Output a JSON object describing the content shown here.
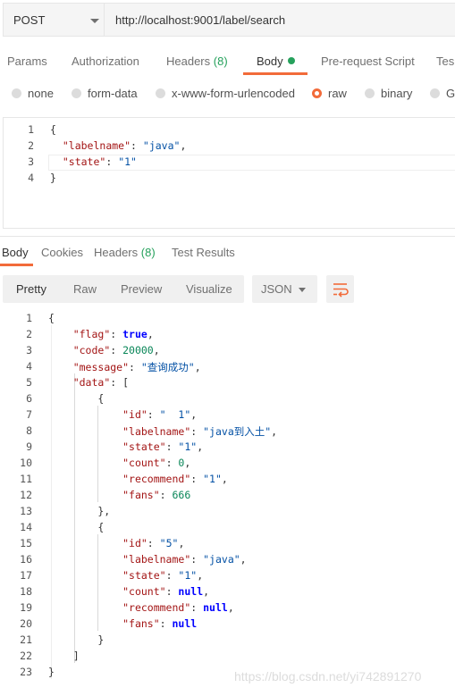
{
  "request": {
    "method": "POST",
    "url": "http://localhost:9001/label/search"
  },
  "request_tabs": [
    {
      "label": "Params"
    },
    {
      "label": "Authorization"
    },
    {
      "label": "Headers",
      "count": "(8)"
    },
    {
      "label": "Body"
    },
    {
      "label": "Pre-request Script"
    },
    {
      "label": "Tes"
    }
  ],
  "body_types": [
    "none",
    "form-data",
    "x-www-form-urlencoded",
    "raw",
    "binary",
    "G"
  ],
  "body_selected": "raw",
  "request_body_lines": [
    [
      [
        "p",
        "{"
      ]
    ],
    [
      [
        "p",
        "  "
      ],
      [
        "k",
        "\"labelname\""
      ],
      [
        "p",
        ": "
      ],
      [
        "s",
        "\"java\""
      ],
      [
        "p",
        ","
      ]
    ],
    [
      [
        "p",
        "  "
      ],
      [
        "k",
        "\"state\""
      ],
      [
        "p",
        ": "
      ],
      [
        "s",
        "\"1\""
      ]
    ],
    [
      [
        "p",
        "}"
      ]
    ]
  ],
  "response_tabs": [
    {
      "label": "Body"
    },
    {
      "label": "Cookies"
    },
    {
      "label": "Headers",
      "count": "(8)"
    },
    {
      "label": "Test Results"
    }
  ],
  "view_modes": [
    "Pretty",
    "Raw",
    "Preview",
    "Visualize"
  ],
  "format": "JSON",
  "response_lines": [
    [
      [
        "p",
        "{"
      ]
    ],
    [
      [
        "p",
        "    "
      ],
      [
        "k",
        "\"flag\""
      ],
      [
        "p",
        ": "
      ],
      [
        "b",
        "true"
      ],
      [
        "p",
        ","
      ]
    ],
    [
      [
        "p",
        "    "
      ],
      [
        "k",
        "\"code\""
      ],
      [
        "p",
        ": "
      ],
      [
        "n",
        "20000"
      ],
      [
        "p",
        ","
      ]
    ],
    [
      [
        "p",
        "    "
      ],
      [
        "k",
        "\"message\""
      ],
      [
        "p",
        ": "
      ],
      [
        "s",
        "\"查询成功\""
      ],
      [
        "p",
        ","
      ]
    ],
    [
      [
        "p",
        "    "
      ],
      [
        "k",
        "\"data\""
      ],
      [
        "p",
        ": ["
      ]
    ],
    [
      [
        "p",
        "        {"
      ]
    ],
    [
      [
        "p",
        "            "
      ],
      [
        "k",
        "\"id\""
      ],
      [
        "p",
        ": "
      ],
      [
        "s",
        "\"  1\""
      ],
      [
        "p",
        ","
      ]
    ],
    [
      [
        "p",
        "            "
      ],
      [
        "k",
        "\"labelname\""
      ],
      [
        "p",
        ": "
      ],
      [
        "s",
        "\"java到入土\""
      ],
      [
        "p",
        ","
      ]
    ],
    [
      [
        "p",
        "            "
      ],
      [
        "k",
        "\"state\""
      ],
      [
        "p",
        ": "
      ],
      [
        "s",
        "\"1\""
      ],
      [
        "p",
        ","
      ]
    ],
    [
      [
        "p",
        "            "
      ],
      [
        "k",
        "\"count\""
      ],
      [
        "p",
        ": "
      ],
      [
        "n",
        "0"
      ],
      [
        "p",
        ","
      ]
    ],
    [
      [
        "p",
        "            "
      ],
      [
        "k",
        "\"recommend\""
      ],
      [
        "p",
        ": "
      ],
      [
        "s",
        "\"1\""
      ],
      [
        "p",
        ","
      ]
    ],
    [
      [
        "p",
        "            "
      ],
      [
        "k",
        "\"fans\""
      ],
      [
        "p",
        ": "
      ],
      [
        "n",
        "666"
      ]
    ],
    [
      [
        "p",
        "        },"
      ]
    ],
    [
      [
        "p",
        "        {"
      ]
    ],
    [
      [
        "p",
        "            "
      ],
      [
        "k",
        "\"id\""
      ],
      [
        "p",
        ": "
      ],
      [
        "s",
        "\"5\""
      ],
      [
        "p",
        ","
      ]
    ],
    [
      [
        "p",
        "            "
      ],
      [
        "k",
        "\"labelname\""
      ],
      [
        "p",
        ": "
      ],
      [
        "s",
        "\"java\""
      ],
      [
        "p",
        ","
      ]
    ],
    [
      [
        "p",
        "            "
      ],
      [
        "k",
        "\"state\""
      ],
      [
        "p",
        ": "
      ],
      [
        "s",
        "\"1\""
      ],
      [
        "p",
        ","
      ]
    ],
    [
      [
        "p",
        "            "
      ],
      [
        "k",
        "\"count\""
      ],
      [
        "p",
        ": "
      ],
      [
        "b",
        "null"
      ],
      [
        "p",
        ","
      ]
    ],
    [
      [
        "p",
        "            "
      ],
      [
        "k",
        "\"recommend\""
      ],
      [
        "p",
        ": "
      ],
      [
        "b",
        "null"
      ],
      [
        "p",
        ","
      ]
    ],
    [
      [
        "p",
        "            "
      ],
      [
        "k",
        "\"fans\""
      ],
      [
        "p",
        ": "
      ],
      [
        "b",
        "null"
      ]
    ],
    [
      [
        "p",
        "        }"
      ]
    ],
    [
      [
        "p",
        "    ]"
      ]
    ],
    [
      [
        "p",
        "}"
      ]
    ]
  ],
  "watermark": "https://blog.csdn.net/yi742891270",
  "colors": {
    "accent": "#f26b3a",
    "count_green": "#26a15c",
    "json_key": "#a31515",
    "json_string": "#0451a5",
    "json_number": "#098658",
    "json_literal": "#0000ff"
  }
}
